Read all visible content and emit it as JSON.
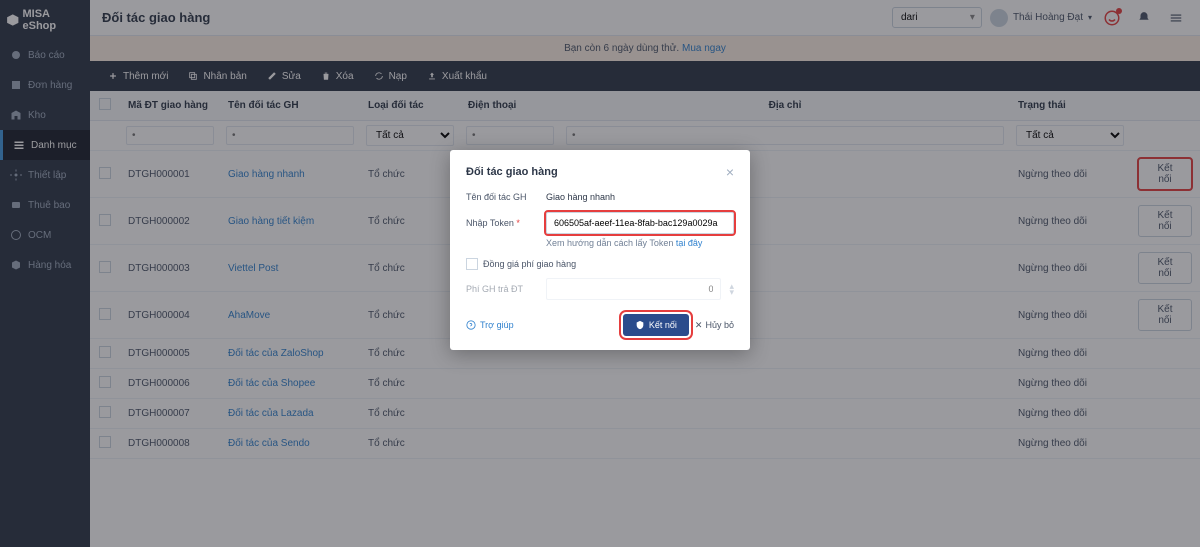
{
  "app_name": "MISA eShop",
  "page_title": "Đối tác giao hàng",
  "trial": {
    "text_before": "Bạn còn 6 ngày dùng thử.",
    "link": "Mua ngay"
  },
  "header": {
    "tenant": "dari",
    "user": "Thái Hoàng Đạt"
  },
  "sidebar": {
    "items": [
      {
        "label": "Báo cáo"
      },
      {
        "label": "Đơn hàng"
      },
      {
        "label": "Kho"
      },
      {
        "label": "Danh mục"
      },
      {
        "label": "Thiết lập"
      },
      {
        "label": "Thuê bao"
      },
      {
        "label": "OCM"
      },
      {
        "label": "Hàng hóa"
      }
    ]
  },
  "toolbar": {
    "add": "Thêm mới",
    "dup": "Nhân bản",
    "edit": "Sửa",
    "del": "Xóa",
    "load": "Nạp",
    "export": "Xuất khẩu"
  },
  "table": {
    "headers": {
      "code": "Mã ĐT giao hàng",
      "partner": "Tên đối tác GH",
      "type": "Loại đối tác",
      "phone": "Điện thoại",
      "address": "Địa chỉ",
      "status": "Trạng thái"
    },
    "filter_all": "Tất cả",
    "connect_label": "Kết nối",
    "status_stop": "Ngừng theo dõi",
    "type_org": "Tổ chức",
    "rows": [
      {
        "code": "DTGH000001",
        "partner": "Giao hàng nhanh",
        "connect": true
      },
      {
        "code": "DTGH000002",
        "partner": "Giao hàng tiết kiệm",
        "connect": true
      },
      {
        "code": "DTGH000003",
        "partner": "Viettel Post",
        "connect": true
      },
      {
        "code": "DTGH000004",
        "partner": "AhaMove",
        "connect": true
      },
      {
        "code": "DTGH000005",
        "partner": "Đối tác của ZaloShop",
        "connect": false
      },
      {
        "code": "DTGH000006",
        "partner": "Đối tác của Shopee",
        "connect": false
      },
      {
        "code": "DTGH000007",
        "partner": "Đối tác của Lazada",
        "connect": false
      },
      {
        "code": "DTGH000008",
        "partner": "Đối tác của Sendo",
        "connect": false
      }
    ]
  },
  "modal": {
    "title": "Đối tác giao hàng",
    "partner_label": "Tên đối tác GH",
    "partner_value": "Giao hàng nhanh",
    "token_label": "Nhập Token",
    "token_value": "606505af-aeef-11ea-8fab-bac129a0029a",
    "hint_text": "Xem hướng dẫn cách lấy Token",
    "hint_link": "tại đây",
    "checkbox_label": "Đồng giá phí giao hàng",
    "fee_label": "Phí GH trả ĐT",
    "fee_value": "0",
    "help": "Trợ giúp",
    "connect": "Kết nối",
    "cancel": "Hủy bỏ"
  }
}
